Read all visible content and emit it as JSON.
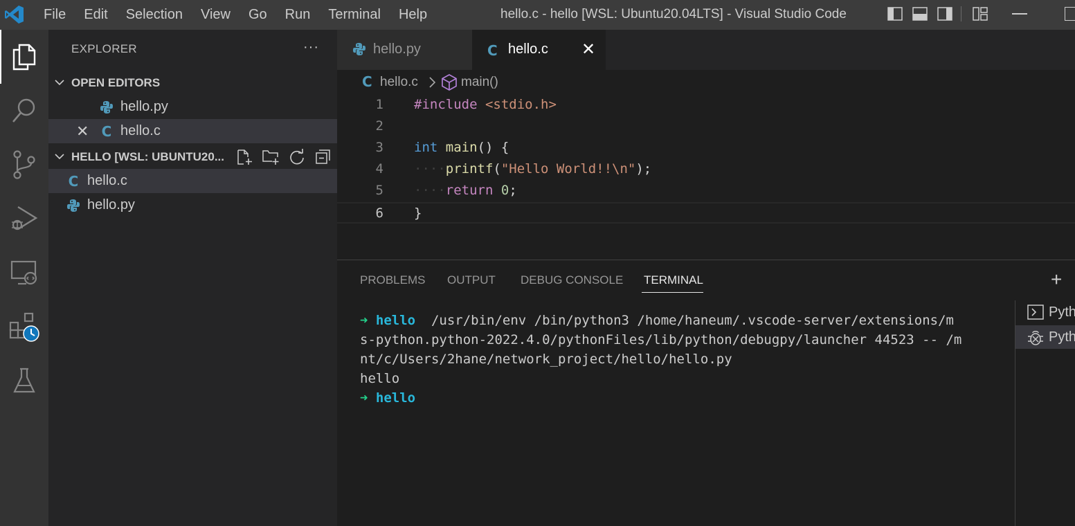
{
  "titlebar": {
    "menu": [
      "File",
      "Edit",
      "Selection",
      "View",
      "Go",
      "Run",
      "Terminal",
      "Help"
    ],
    "window_title": "hello.c - hello [WSL: Ubuntu20.04LTS] - Visual Studio Code"
  },
  "activity_bar": {
    "items": [
      "explorer-icon",
      "search-icon",
      "source-control-icon",
      "run-debug-icon",
      "remote-explorer-icon",
      "extensions-icon",
      "testing-icon"
    ],
    "active": "explorer-icon"
  },
  "sidebar": {
    "header": "EXPLORER",
    "more": "···",
    "open_editors": {
      "title": "OPEN EDITORS",
      "files": [
        {
          "name": "hello.py",
          "icon": "python-icon"
        },
        {
          "name": "hello.c",
          "icon": "c-icon",
          "close": "✕"
        }
      ]
    },
    "workspace": {
      "title": "HELLO [WSL: UBUNTU20...",
      "files": [
        {
          "name": "hello.c",
          "icon": "c-icon"
        },
        {
          "name": "hello.py",
          "icon": "python-icon"
        }
      ]
    }
  },
  "editor": {
    "tabs": [
      {
        "label": "hello.py",
        "icon": "python-icon",
        "active": false
      },
      {
        "label": "hello.c",
        "icon": "c-icon",
        "active": true,
        "close": "✕"
      }
    ],
    "breadcrumb": {
      "file": "hello.c",
      "symbol": "main()"
    },
    "c_letter": "C",
    "lines": [
      {
        "num": "1",
        "tokens": [
          {
            "t": "#include ",
            "c": "kw-pre"
          },
          {
            "t": "<stdio.h>",
            "c": "str"
          }
        ]
      },
      {
        "num": "2",
        "tokens": []
      },
      {
        "num": "3",
        "tokens": [
          {
            "t": "int",
            "c": "kw"
          },
          {
            "t": " ",
            "c": ""
          },
          {
            "t": "main",
            "c": "fn"
          },
          {
            "t": "() {",
            "c": ""
          }
        ]
      },
      {
        "num": "4",
        "tokens": [
          {
            "t": "····",
            "c": "ws"
          },
          {
            "t": "printf",
            "c": "fn"
          },
          {
            "t": "(",
            "c": ""
          },
          {
            "t": "\"Hello World!!\\n\"",
            "c": "str"
          },
          {
            "t": ");",
            "c": ""
          }
        ]
      },
      {
        "num": "5",
        "tokens": [
          {
            "t": "····",
            "c": "ws"
          },
          {
            "t": "return",
            "c": "kw-pre"
          },
          {
            "t": " ",
            "c": ""
          },
          {
            "t": "0",
            "c": "num"
          },
          {
            "t": ";",
            "c": ""
          }
        ]
      },
      {
        "num": "6",
        "tokens": [
          {
            "t": "}",
            "c": ""
          }
        ]
      }
    ],
    "current_line": "6"
  },
  "panel": {
    "tabs": [
      "PROBLEMS",
      "OUTPUT",
      "DEBUG CONSOLE",
      "TERMINAL"
    ],
    "active_tab": "TERMINAL",
    "add": "+",
    "terminal_lines": [
      [
        {
          "t": "➜ ",
          "c": "arrow"
        },
        {
          "t": "hello",
          "c": "dir"
        },
        {
          "t": "  /usr/bin/env /bin/python3 /home/haneum/.vscode-server/extensions/m",
          "c": ""
        }
      ],
      [
        {
          "t": "s-python.python-2022.4.0/pythonFiles/lib/python/debugpy/launcher 44523 -- /m",
          "c": ""
        }
      ],
      [
        {
          "t": "nt/c/Users/2hane/network_project/hello/hello.py",
          "c": ""
        }
      ],
      [
        {
          "t": "hello",
          "c": ""
        }
      ],
      [
        {
          "t": "➜ ",
          "c": "arrow"
        },
        {
          "t": "hello",
          "c": "dir"
        }
      ]
    ],
    "terminal_list": [
      {
        "name": "Pyth",
        "icon": "terminal-icon",
        "selected": false
      },
      {
        "name": "Pyth",
        "icon": "debug-icon",
        "selected": true
      }
    ]
  },
  "colors": {
    "accent": "#007acc",
    "python": "#519aba",
    "c": "#519aba"
  }
}
